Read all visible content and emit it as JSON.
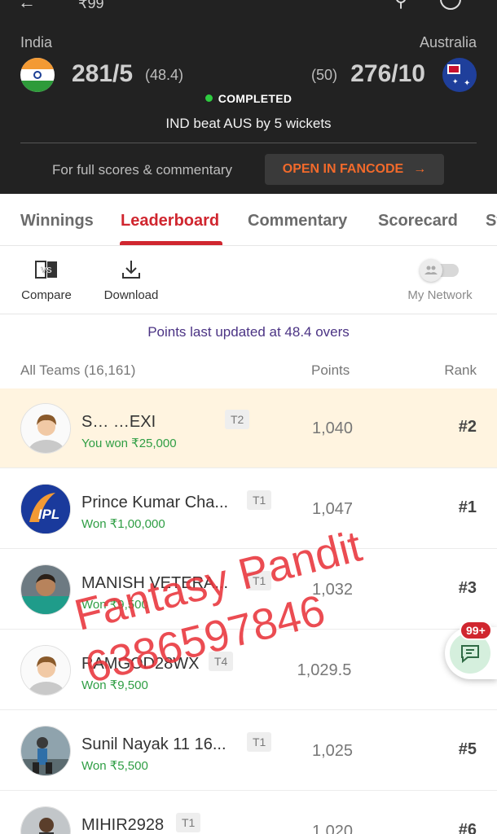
{
  "topbar": {
    "price": "₹99"
  },
  "match": {
    "left_team": {
      "name": "India",
      "score": "281/5",
      "overs": "(48.4)"
    },
    "right_team": {
      "name": "Australia",
      "score": "276/10",
      "overs": "(50)"
    },
    "status": "COMPLETED",
    "result": "IND beat AUS by 5 wickets",
    "full_scores_text": "For full scores & commentary",
    "fancode_button": "OPEN IN FANCODE",
    "status_color": "#2ecc40",
    "accent_color": "#f26a2b"
  },
  "tabs": [
    {
      "label": "Winnings",
      "active": false
    },
    {
      "label": "Leaderboard",
      "active": true
    },
    {
      "label": "Commentary",
      "active": false
    },
    {
      "label": "Scorecard",
      "active": false
    },
    {
      "label": "St",
      "active": false
    }
  ],
  "tools": {
    "compare_label": "Compare",
    "download_label": "Download",
    "network_label": "My Network",
    "network_enabled": false
  },
  "points_updated": "Points last updated at 48.4 overs",
  "list_header": {
    "teams": "All Teams (16,161)",
    "points": "Points",
    "rank": "Rank"
  },
  "rows": [
    {
      "name": "S…        …EXI",
      "tag": "T2",
      "won": "You won ₹25,000",
      "points": "1,040",
      "rank": "#2",
      "avatar": "default-avatar",
      "me": true
    },
    {
      "name": "Prince Kumar Cha...",
      "tag": "T1",
      "won": "Won ₹1,00,000",
      "points": "1,047",
      "rank": "#1",
      "avatar": "ipl-logo-avatar",
      "me": false
    },
    {
      "name": "MANISH VETERA...",
      "tag": "T1",
      "won": "Won ₹9,500",
      "points": "1,032",
      "rank": "#3",
      "avatar": "photo-avatar",
      "me": false
    },
    {
      "name": "RAMGOD28WX",
      "tag": "T4",
      "won": "Won ₹9,500",
      "points": "1,029.5",
      "rank": "",
      "avatar": "default-avatar",
      "me": false
    },
    {
      "name": "Sunil Nayak 11 16...",
      "tag": "T1",
      "won": "Won ₹5,500",
      "points": "1,025",
      "rank": "#5",
      "avatar": "photo-avatar",
      "me": false
    },
    {
      "name": "MIHIR2928",
      "tag": "T1",
      "won": "",
      "points": "1,020",
      "rank": "#6",
      "avatar": "photo-avatar",
      "me": false
    }
  ],
  "watermark": {
    "line1": "Fantasy Pandit",
    "line2": "6386597846",
    "color": "#e8333a"
  },
  "chat_fab": {
    "badge": "99+"
  }
}
